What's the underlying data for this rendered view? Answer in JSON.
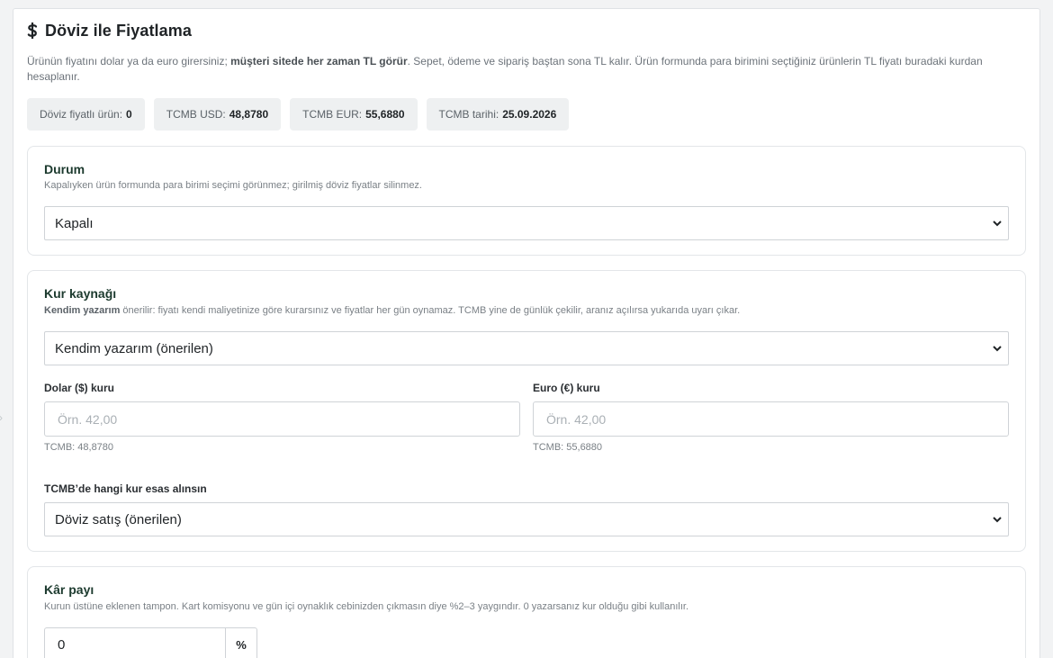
{
  "header": {
    "title": "Döviz ile Fiyatlama",
    "icon": "dollar-icon",
    "intro_part1": "Ürünün fiyatını dolar ya da euro girersiniz; ",
    "intro_bold": "müşteri sitede her zaman TL görür",
    "intro_part2": ". Sepet, ödeme ve sipariş baştan sona TL kalır. Ürün formunda para birimini seçtiğiniz ürünlerin TL fiyatı buradaki kurdan hesaplanır."
  },
  "chips": [
    {
      "label": "Döviz fiyatlı ürün:",
      "value": "0"
    },
    {
      "label": "TCMB USD:",
      "value": "48,8780"
    },
    {
      "label": "TCMB EUR:",
      "value": "55,6880"
    },
    {
      "label": "TCMB tarihi:",
      "value": "25.09.2026"
    }
  ],
  "status": {
    "title": "Durum",
    "description": "Kapalıyken ürün formunda para birimi seçimi görünmez; girilmiş döviz fiyatlar silinmez.",
    "selected": "Kapalı"
  },
  "rate_source": {
    "title": "Kur kaynağı",
    "desc_bold": "Kendim yazarım",
    "desc_rest": " önerilir: fiyatı kendi maliyetinize göre kurarsınız ve fiyatlar her gün oynamaz. TCMB yine de günlük çekilir, aranız açılırsa yukarıda uyarı çıkar.",
    "selected": "Kendim yazarım (önerilen)",
    "usd_label": "Dolar ($) kuru",
    "usd_placeholder": "Örn. 42,00",
    "usd_hint": "TCMB: 48,8780",
    "eur_label": "Euro (€) kuru",
    "eur_placeholder": "Örn. 42,00",
    "eur_hint": "TCMB: 55,6880",
    "basis_label": "TCMB’de hangi kur esas alınsın",
    "basis_selected": "Döviz satış (önerilen)"
  },
  "margin": {
    "title": "Kâr payı",
    "description": "Kurun üstüne eklenen tampon. Kart komisyonu ve gün içi oynaklık cebinizden çıkmasın diye %2–3 yaygındır. 0 yazarsanız kur olduğu gibi kullanılır.",
    "value": "0",
    "unit": "%"
  }
}
